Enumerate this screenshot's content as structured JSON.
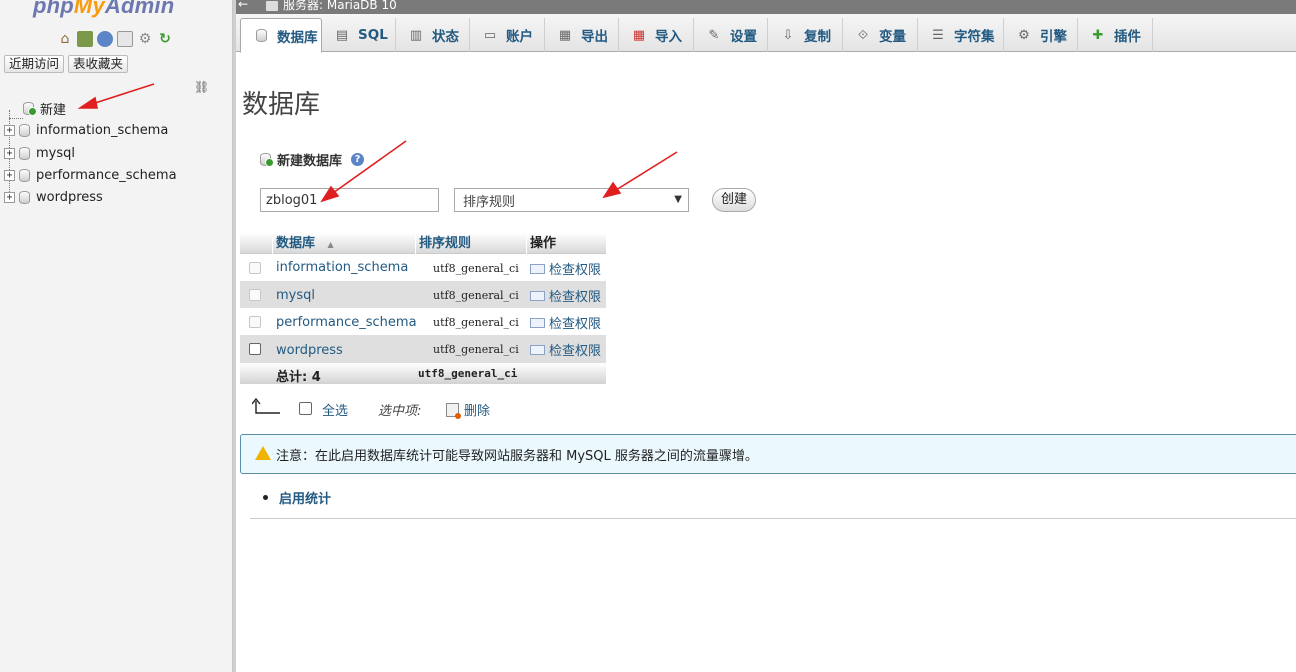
{
  "logo": {
    "php": "php",
    "my": "My",
    "admin": "Admin"
  },
  "left": {
    "recent_label": "近期访问",
    "favorites_label": "表收藏夹",
    "tree": [
      {
        "label": "新建",
        "type": "new"
      },
      {
        "label": "information_schema",
        "type": "db"
      },
      {
        "label": "mysql",
        "type": "db"
      },
      {
        "label": "performance_schema",
        "type": "db"
      },
      {
        "label": "wordpress",
        "type": "db"
      }
    ]
  },
  "topbar": {
    "back_icon": "←",
    "server": "服务器: MariaDB 10"
  },
  "tabs": [
    {
      "label": "数据库",
      "icon": "database-icon",
      "active": true
    },
    {
      "label": "SQL",
      "icon": "sql-icon"
    },
    {
      "label": "状态",
      "icon": "status-icon"
    },
    {
      "label": "账户",
      "icon": "accounts-icon"
    },
    {
      "label": "导出",
      "icon": "export-icon"
    },
    {
      "label": "导入",
      "icon": "import-icon"
    },
    {
      "label": "设置",
      "icon": "settings-icon"
    },
    {
      "label": "复制",
      "icon": "replication-icon"
    },
    {
      "label": "变量",
      "icon": "variables-icon"
    },
    {
      "label": "字符集",
      "icon": "charset-icon"
    },
    {
      "label": "引擎",
      "icon": "engines-icon"
    },
    {
      "label": "插件",
      "icon": "plugins-icon"
    }
  ],
  "main": {
    "title": "数据库",
    "create_section": {
      "title": "新建数据库",
      "db_name_value": "zblog01",
      "collation_placeholder": "排序规则",
      "create_button": "创建"
    },
    "table": {
      "headers": {
        "database": "数据库",
        "sort_indicator": "▲",
        "collation": "排序规则",
        "action": "操作"
      },
      "rows": [
        {
          "name": "information_schema",
          "collation": "utf8_general_ci",
          "action": "检查权限"
        },
        {
          "name": "mysql",
          "collation": "utf8_general_ci",
          "action": "检查权限"
        },
        {
          "name": "performance_schema",
          "collation": "utf8_general_ci",
          "action": "检查权限"
        },
        {
          "name": "wordpress",
          "collation": "utf8_general_ci",
          "action": "检查权限"
        }
      ],
      "footer": {
        "total": "总计: 4",
        "collation": "utf8_general_ci"
      }
    },
    "bulk": {
      "select_all": "全选",
      "with_selected": "选中项:",
      "delete": "删除"
    },
    "notice": "注意：在此启用数据库统计可能导致网站服务器和 MySQL 服务器之间的流量骤增。",
    "enable_stats": "启用统计"
  },
  "colors": {
    "link": "#235a81",
    "annotation_arrow": "#e02020",
    "notice_border": "#5a8ba7"
  }
}
